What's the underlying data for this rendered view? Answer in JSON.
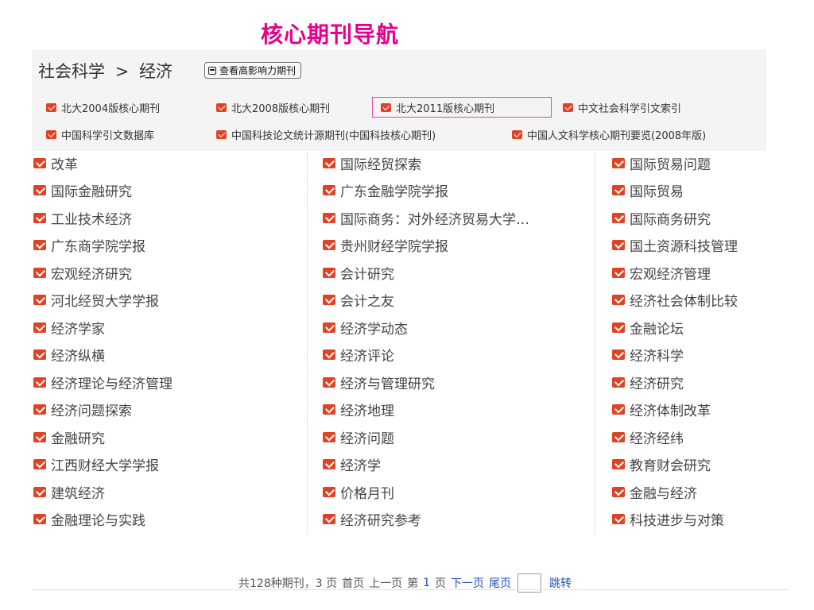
{
  "page_title": "核心期刊导航",
  "breadcrumb": {
    "root": "社会科学",
    "sep": ">",
    "current": "经济"
  },
  "view_button": "查看高影响力期刊",
  "categories": [
    {
      "label": "北大2004版核心期刊",
      "selected": false
    },
    {
      "label": "北大2008版核心期刊",
      "selected": false
    },
    {
      "label": "北大2011版核心期刊",
      "selected": true
    },
    {
      "label": "中文社会科学引文索引",
      "selected": false
    },
    {
      "label": "中国科学引文数据库",
      "selected": false
    },
    {
      "label": "中国科技论文统计源期刊(中国科技核心期刊)",
      "selected": false
    },
    {
      "label": "中国人文科学核心期刊要览(2008年版)",
      "selected": false
    }
  ],
  "journals": {
    "col1": [
      "改革",
      "国际金融研究",
      "工业技术经济",
      "广东商学院学报",
      "宏观经济研究",
      "河北经贸大学学报",
      "经济学家",
      "经济纵横",
      "经济理论与经济管理",
      "经济问题探索",
      "金融研究",
      "江西财经大学学报",
      "建筑经济",
      "金融理论与实践"
    ],
    "col2": [
      "国际经贸探索",
      "广东金融学院学报",
      "国际商务：对外经济贸易大学…",
      "贵州财经学院学报",
      "会计研究",
      "会计之友",
      "经济学动态",
      "经济评论",
      "经济与管理研究",
      "经济地理",
      "经济问题",
      "经济学",
      "价格月刊",
      "经济研究参考"
    ],
    "col3": [
      "国际贸易问题",
      "国际贸易",
      "国际商务研究",
      "国土资源科技管理",
      "宏观经济管理",
      "经济社会体制比较",
      "金融论坛",
      "经济科学",
      "经济研究",
      "经济体制改革",
      "经济经纬",
      "教育财会研究",
      "金融与经济",
      "科技进步与对策"
    ]
  },
  "pager": {
    "summary": "共128种期刊，3 页",
    "first": "首页",
    "prev": "上一页",
    "di": "第",
    "current_page": "1",
    "ye": "页",
    "next": "下一页",
    "last": "尾页",
    "input_value": "",
    "jump": "跳转"
  },
  "colors": {
    "title": "#e6008a",
    "icon": "#e04224",
    "link": "#1f4fbf",
    "selected_border": "#e04aa8"
  }
}
